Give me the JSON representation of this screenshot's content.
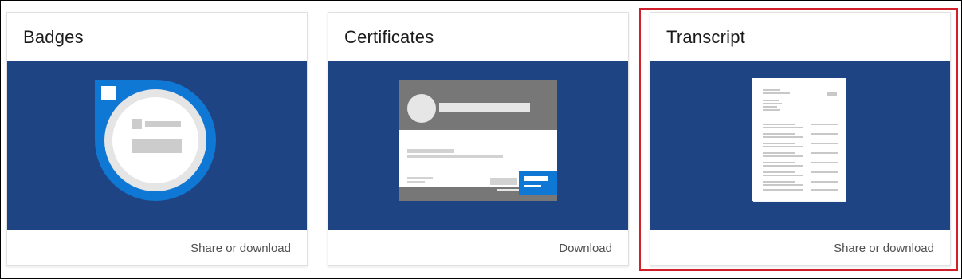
{
  "cards": [
    {
      "title": "Badges",
      "action": "Share or download",
      "illustration": "badge-graphic"
    },
    {
      "title": "Certificates",
      "action": "Download",
      "illustration": "certificate-graphic"
    },
    {
      "title": "Transcript",
      "action": "Share or download",
      "illustration": "transcript-graphic"
    }
  ],
  "colors": {
    "card_image_bg": "#1f4483",
    "badge_ring": "#0f78d4",
    "highlight": "#d1202a",
    "action_text": "#505050"
  }
}
